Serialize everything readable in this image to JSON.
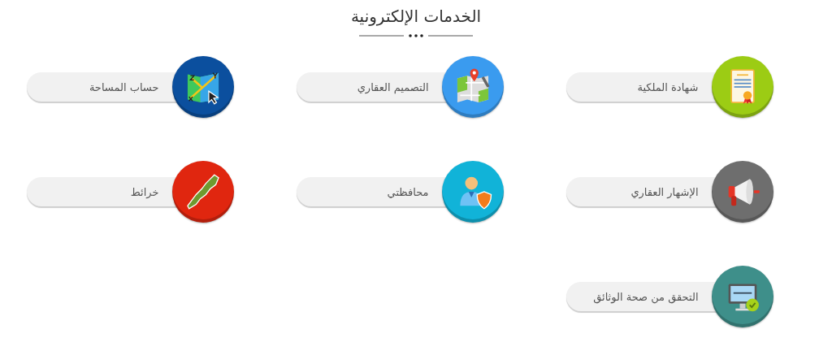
{
  "title": "الخدمات الإلكترونية",
  "services": [
    {
      "label": "شهادة الملكية",
      "kind": "certificate",
      "color": "#9ccc14"
    },
    {
      "label": "التصميم العقاري",
      "kind": "city-map",
      "color": "#3a9bef"
    },
    {
      "label": "حساب المساحة",
      "kind": "axes-map",
      "color": "#0b4f9e"
    },
    {
      "label": "الإشهار العقاري",
      "kind": "megaphone",
      "color": "#6e6e6e"
    },
    {
      "label": "محافظتي",
      "kind": "user-shield",
      "color": "#11b3d8"
    },
    {
      "label": "خرائط",
      "kind": "country-map",
      "color": "#e0260f"
    },
    {
      "label": "التحقق من صحة الوثائق",
      "kind": "monitor-check",
      "color": "#3e8f8a"
    }
  ]
}
